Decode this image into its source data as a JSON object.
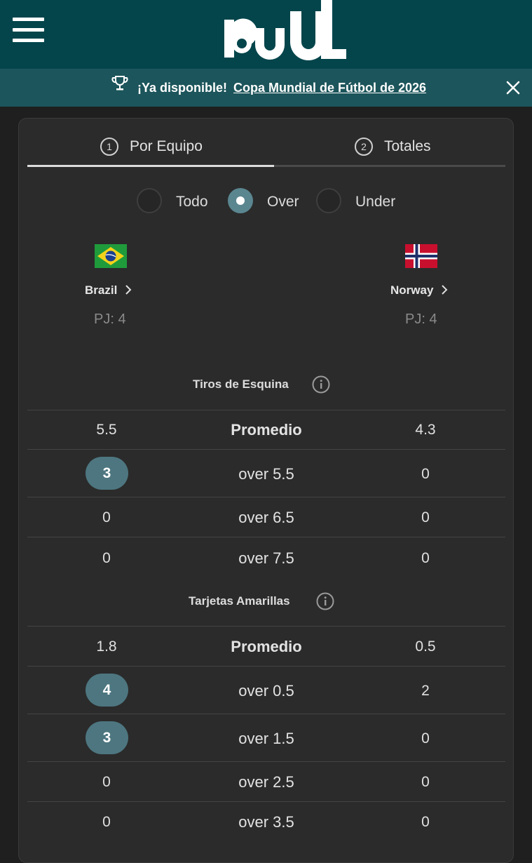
{
  "header": {
    "logo_text": "buUL"
  },
  "banner": {
    "text": "¡Ya disponible!",
    "link": "Copa Mundial de Fútbol de 2026"
  },
  "tabs": [
    {
      "num": "1",
      "label": "Por Equipo",
      "active": true
    },
    {
      "num": "2",
      "label": "Totales",
      "active": false
    }
  ],
  "filters": {
    "options": [
      "Todo",
      "Over",
      "Under"
    ],
    "selected": "Over"
  },
  "teams": {
    "home": {
      "name": "Brazil",
      "pj": "PJ: 4"
    },
    "away": {
      "name": "Norway",
      "pj": "PJ: 4"
    }
  },
  "sections": [
    {
      "title": "Tiros de Esquina",
      "rows": [
        {
          "left": "5.5",
          "label": "Promedio",
          "right": "4.3",
          "highlight_left": false
        },
        {
          "left": "3",
          "label": "over 5.5",
          "right": "0",
          "highlight_left": true
        },
        {
          "left": "0",
          "label": "over 6.5",
          "right": "0",
          "highlight_left": false
        },
        {
          "left": "0",
          "label": "over 7.5",
          "right": "0",
          "highlight_left": false
        }
      ]
    },
    {
      "title": "Tarjetas Amarillas",
      "rows": [
        {
          "left": "1.8",
          "label": "Promedio",
          "right": "0.5",
          "highlight_left": false
        },
        {
          "left": "4",
          "label": "over 0.5",
          "right": "2",
          "highlight_left": true
        },
        {
          "left": "3",
          "label": "over 1.5",
          "right": "0",
          "highlight_left": true
        },
        {
          "left": "0",
          "label": "over 2.5",
          "right": "0",
          "highlight_left": false
        },
        {
          "left": "0",
          "label": "over 3.5",
          "right": "0",
          "highlight_left": false
        }
      ]
    }
  ],
  "colors": {
    "header_bg": "#03454b",
    "banner_bg": "#1c555b",
    "accent_pill": "#4d7680",
    "card_bg": "#2b2b2b"
  }
}
